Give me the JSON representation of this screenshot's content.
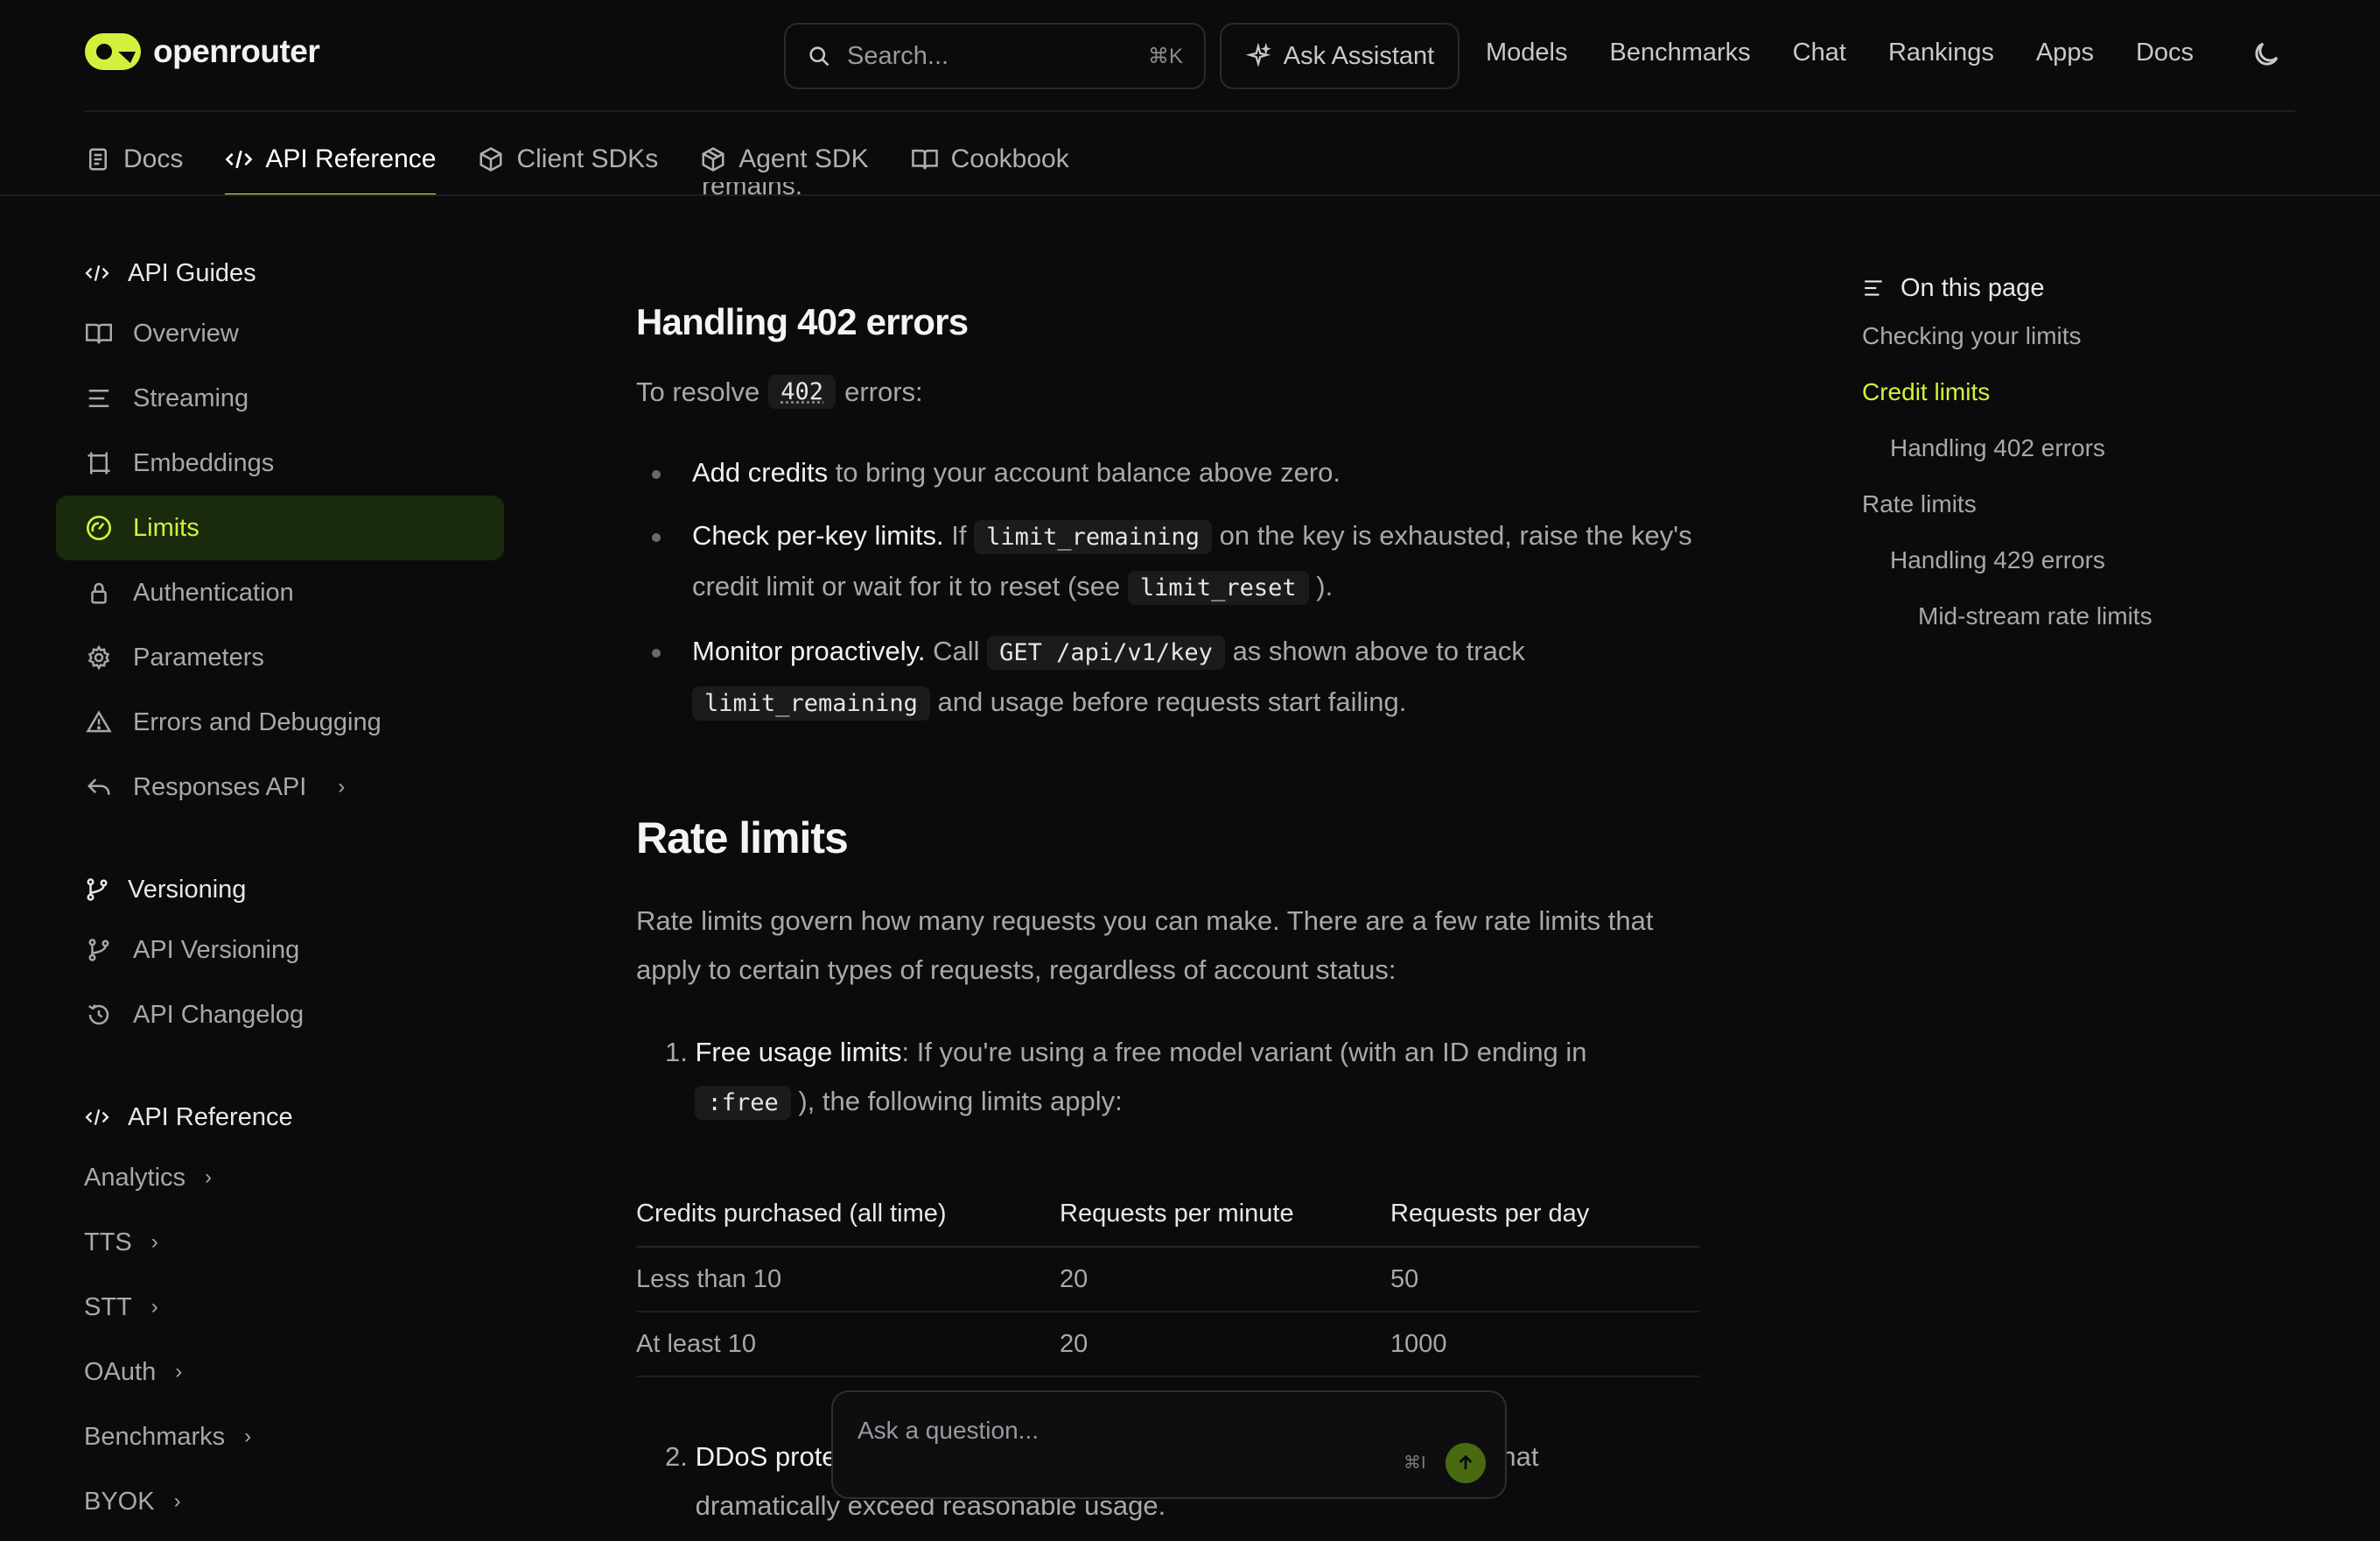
{
  "header": {
    "brand": "openrouter",
    "search_placeholder": "Search...",
    "search_shortcut": "⌘K",
    "ask_assistant": "Ask Assistant",
    "nav": [
      "Models",
      "Benchmarks",
      "Chat",
      "Rankings",
      "Apps",
      "Docs"
    ]
  },
  "tabs": [
    {
      "label": "Docs",
      "icon": "document-icon"
    },
    {
      "label": "API Reference",
      "icon": "code-icon",
      "active": true
    },
    {
      "label": "Client SDKs",
      "icon": "cube-icon"
    },
    {
      "label": "Agent SDK",
      "icon": "package-icon"
    },
    {
      "label": "Cookbook",
      "icon": "book-icon"
    }
  ],
  "sidebar": {
    "guides_title": "API Guides",
    "guides": [
      {
        "label": "Overview",
        "icon": "book-open-icon"
      },
      {
        "label": "Streaming",
        "icon": "lines-icon"
      },
      {
        "label": "Embeddings",
        "icon": "frame-icon"
      },
      {
        "label": "Limits",
        "icon": "gauge-icon",
        "active": true
      },
      {
        "label": "Authentication",
        "icon": "lock-icon"
      },
      {
        "label": "Parameters",
        "icon": "gear-icon"
      },
      {
        "label": "Errors and Debugging",
        "icon": "warning-icon"
      },
      {
        "label": "Responses API",
        "icon": "reply-icon",
        "expandable": true
      }
    ],
    "versioning_title": "Versioning",
    "versioning": [
      {
        "label": "API Versioning",
        "icon": "branch-icon"
      },
      {
        "label": "API Changelog",
        "icon": "history-icon"
      }
    ],
    "reference_title": "API Reference",
    "reference": [
      "Analytics",
      "TTS",
      "STT",
      "OAuth",
      "Benchmarks",
      "BYOK"
    ]
  },
  "content": {
    "cut_text": "remains.",
    "h402": "Handling 402 errors",
    "resolve_pre": "To resolve",
    "resolve_code": "402",
    "resolve_post": "errors:",
    "b1_bold": "Add credits",
    "b1_text": " to bring your account balance above zero.",
    "b2_bold": "Check per-key limits.",
    "b2_t1": " If ",
    "b2_code1": "limit_remaining",
    "b2_t2": " on the key is exhausted, raise the key's credit limit or wait for it to reset (see ",
    "b2_code2": "limit_reset",
    "b2_t3": " ).",
    "b3_bold": "Monitor proactively.",
    "b3_t1": " Call ",
    "b3_code1": "GET /api/v1/key",
    "b3_t2": " as shown above to track ",
    "b3_code2": "limit_remaining",
    "b3_t3": " and usage before requests start failing.",
    "rate_title": "Rate limits",
    "rate_intro": "Rate limits govern how many requests you can make. There are a few rate limits that apply to certain types of requests, regardless of account status:",
    "ol1_num": "1.",
    "ol1_bold": "Free usage limits",
    "ol1_t1": ": If you're using a free model variant (with an ID ending in ",
    "ol1_code": ":free",
    "ol1_t2": " ), the following limits apply:",
    "table": {
      "headers": [
        "Credits purchased (all time)",
        "Requests per minute",
        "Requests per day"
      ],
      "rows": [
        [
          "Less than 10",
          "20",
          "50"
        ],
        [
          "At least 10",
          "20",
          "1000"
        ]
      ]
    },
    "ol2_num": "2.",
    "ol2_bold": "DDoS protection",
    "ol2_text": ": Cloudflare's DDoS protection will block requests that dramatically exceed reasonable usage."
  },
  "ask_box": {
    "placeholder": "Ask a question...",
    "shortcut": "⌘I"
  },
  "toc": {
    "title": "On this page",
    "items": [
      {
        "label": "Checking your limits",
        "level": 1
      },
      {
        "label": "Credit limits",
        "level": 1,
        "active": true
      },
      {
        "label": "Handling 402 errors",
        "level": 2
      },
      {
        "label": "Rate limits",
        "level": 1
      },
      {
        "label": "Handling 429 errors",
        "level": 2
      },
      {
        "label": "Mid-stream rate limits",
        "level": 3
      }
    ]
  },
  "colors": {
    "accent": "#d4f03c",
    "background": "#0b0b0c",
    "active_bg": "#1a2a0c"
  }
}
